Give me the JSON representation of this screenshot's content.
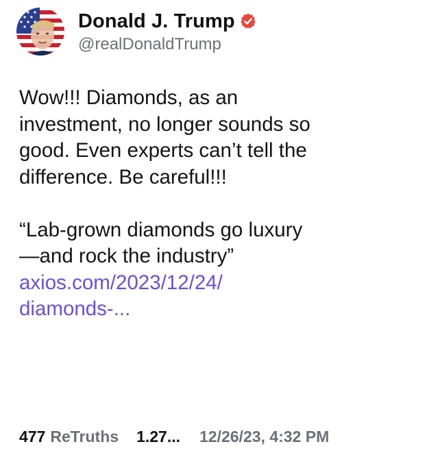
{
  "author": {
    "display_name": "Donald J. Trump",
    "handle": "@realDonaldTrump",
    "verified_icon": "verified-badge-icon",
    "avatar_icon": "profile-avatar"
  },
  "post": {
    "text_lines": [
      "Wow!!! Diamonds, as an",
      "investment, no longer sounds so",
      "good. Even experts can’t tell the",
      "difference. Be careful!!!"
    ],
    "quote_lines": [
      "“Lab-grown diamonds go luxury",
      "—and rock the industry”"
    ],
    "link_lines": [
      "axios.com/2023/12/24/",
      "diamonds-..."
    ]
  },
  "stats": {
    "retruths_count": "477",
    "retruths_label": "ReTruths",
    "likes_count": "1.27...",
    "timestamp": "12/26/23, 4:32 PM"
  },
  "colors": {
    "link": "#6a4ee0",
    "verified": "#e8453c",
    "muted_text": "#6e6e78",
    "text": "#141414"
  }
}
